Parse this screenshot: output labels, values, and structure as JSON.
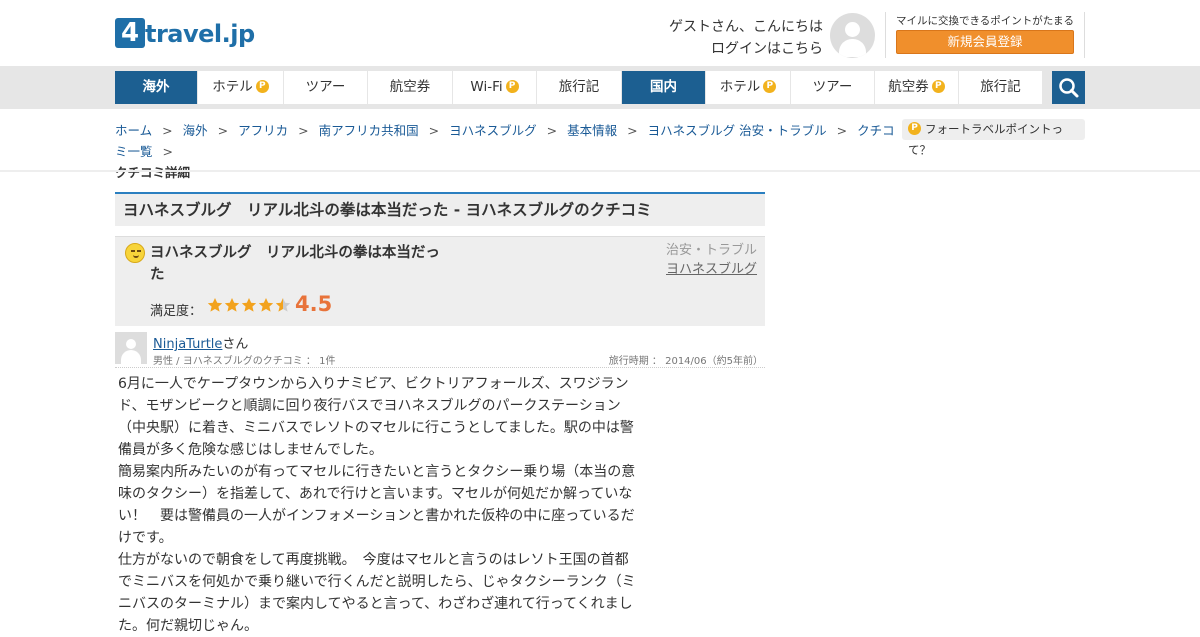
{
  "header": {
    "logo_mark": "4",
    "logo_text": "travel.jp",
    "greeting": "ゲストさん、こんにちは",
    "login_link": "ログインはこちら",
    "mile_note": "マイルに交換できるポイントがたまる",
    "register_button": "新規会員登録"
  },
  "nav": {
    "items": [
      {
        "label": "海外",
        "active": true,
        "point": false
      },
      {
        "label": "ホテル",
        "active": false,
        "point": true
      },
      {
        "label": "ツアー",
        "active": false,
        "point": false
      },
      {
        "label": "航空券",
        "active": false,
        "point": false
      },
      {
        "label": "Wi-Fi",
        "active": false,
        "point": true
      },
      {
        "label": "旅行記",
        "active": false,
        "point": false
      },
      {
        "label": "国内",
        "active": true,
        "point": false
      },
      {
        "label": "ホテル",
        "active": false,
        "point": true
      },
      {
        "label": "ツアー",
        "active": false,
        "point": false
      },
      {
        "label": "航空券",
        "active": false,
        "point": true
      },
      {
        "label": "旅行記",
        "active": false,
        "point": false
      }
    ],
    "point_badge": "P",
    "search_icon": "search-icon"
  },
  "breadcrumb": {
    "items": [
      "ホーム",
      "海外",
      "アフリカ",
      "南アフリカ共和国",
      "ヨハネスブルグ",
      "基本情報",
      "ヨハネスブルグ 治安・トラブル",
      "クチコミ一覧"
    ],
    "separator": ">",
    "current": "クチコミ詳細",
    "point_link": "フォートラベルポイントって？"
  },
  "page": {
    "title": "ヨハネスブルグ　リアル北斗の拳は本当だった - ヨハネスブルグのクチコミ"
  },
  "review": {
    "title": "ヨハネスブルグ　リアル北斗の拳は本当だった",
    "category": "治安・トラブル",
    "city": "ヨハネスブルグ",
    "rating_label": "満足度：",
    "rating_value": "4.5",
    "rating": 4.5,
    "star_color": "#f2a21d",
    "star_empty_color": "#ccc"
  },
  "user": {
    "name": "NinjaTurtle",
    "suffix": "さん",
    "meta": "男性 / ヨハネスブルグのクチコミ ： 1件",
    "travel_date": "旅行時期 ： 2014/06（約5年前）"
  },
  "body": {
    "paragraphs": [
      "6月に一人でケープタウンから入りナミビア、ビクトリアフォールズ、スワジランド、モザンビークと順調に回り夜行バスでヨハネスブルグのパークステーション（中央駅）に着き、ミニバスでレソトのマセルに行こうとしてました。駅の中は警備員が多く危険な感じはしませんでした。",
      "簡易案内所みたいのが有ってマセルに行きたいと言うとタクシー乗り場（本当の意味のタクシー）を指差して、あれで行けと言います。マセルが何処だか解っていない！　要は警備員の一人がインフォメーションと書かれた仮枠の中に座っているだけです。",
      "仕方がないので朝食をして再度挑戦。　今度はマセルと言うのはレソト王国の首都でミニバスを何処かで乗り継いで行くんだと説明したら、じゃタクシーランク（ミニバスのターミナル）まで案内してやると言って、わざわざ連れて行ってくれました。何だ親切じゃん。"
    ]
  }
}
